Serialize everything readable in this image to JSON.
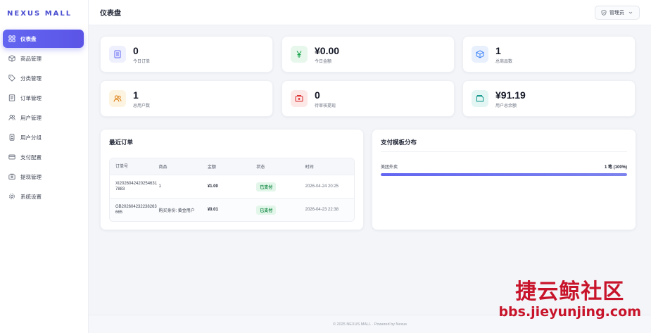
{
  "brand": "NEXUS MALL",
  "sidebar": {
    "items": [
      {
        "label": "仪表盘",
        "icon": "dashboard-icon"
      },
      {
        "label": "商品管理",
        "icon": "box-icon"
      },
      {
        "label": "分类管理",
        "icon": "tag-icon"
      },
      {
        "label": "订单管理",
        "icon": "list-icon"
      },
      {
        "label": "用户管理",
        "icon": "users-icon"
      },
      {
        "label": "用户分组",
        "icon": "id-card-icon"
      },
      {
        "label": "支付配置",
        "icon": "credit-card-icon"
      },
      {
        "label": "提现管理",
        "icon": "cash-icon"
      },
      {
        "label": "系统设置",
        "icon": "gear-icon"
      }
    ]
  },
  "header": {
    "title": "仪表盘",
    "user": "管理员"
  },
  "stats": [
    {
      "value": "0",
      "label": "今日订单",
      "icon": "document-icon",
      "color": "#6366f1",
      "bg": "#eef0fd"
    },
    {
      "value": "¥0.00",
      "label": "今日金额",
      "icon": "yen-icon",
      "color": "#16a34a",
      "bg": "#e7f7ec"
    },
    {
      "value": "1",
      "label": "总商品数",
      "icon": "cube-icon",
      "color": "#3b82f6",
      "bg": "#e8f0fd"
    },
    {
      "value": "1",
      "label": "总用户数",
      "icon": "users-icon",
      "color": "#d97706",
      "bg": "#fdf3e1"
    },
    {
      "value": "0",
      "label": "待审核提现",
      "icon": "cash-icon",
      "color": "#dc2626",
      "bg": "#fde8e8"
    },
    {
      "value": "¥91.19",
      "label": "用户总余额",
      "icon": "wallet-icon",
      "color": "#0d9488",
      "bg": "#e3f6f3"
    }
  ],
  "orders": {
    "title": "最近订单",
    "columns": [
      "订单号",
      "商品",
      "金额",
      "状态",
      "时间"
    ],
    "rows": [
      {
        "id_line1": "XI2026042420254631",
        "id_line2": "7883",
        "product": "1",
        "amount": "¥1.00",
        "status": "已支付",
        "time": "2026-04-24 20:25"
      },
      {
        "id_line1": "GB202604232238263",
        "id_line2": "665",
        "product": "购买身份: 黄金用户",
        "amount": "¥0.01",
        "status": "已支付",
        "time": "2026-04-23 22:38"
      }
    ]
  },
  "distribution": {
    "title": "支付模板分布",
    "items": [
      {
        "label": "美团外卖",
        "value_text": "1 笔 (100%)",
        "percent": 100
      }
    ]
  },
  "footer": "© 2025 NEXUS MALL · Powered by Nexus",
  "watermark": {
    "line1": "捷云鲸社区",
    "line2": "bbs.jieyunjing.com"
  },
  "colors": {
    "accent": "#6366f1",
    "success": "#168a46",
    "watermark": "#c8142a"
  }
}
